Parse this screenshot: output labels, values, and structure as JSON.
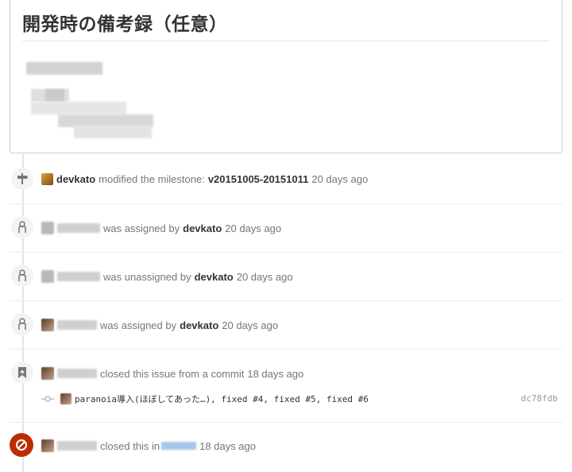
{
  "comment": {
    "title": "開発時の備考録（任意）"
  },
  "events": [
    {
      "type": "milestone",
      "actor": "devkato",
      "action": "modified the milestone:",
      "milestone": "v20151005-20151011",
      "time": "20 days ago"
    },
    {
      "type": "assign",
      "action": "was assigned by",
      "actor": "devkato",
      "time": "20 days ago"
    },
    {
      "type": "unassign",
      "action": "was unassigned by",
      "actor": "devkato",
      "time": "20 days ago"
    },
    {
      "type": "assign",
      "action": "was assigned by",
      "actor": "devkato",
      "time": "20 days ago"
    },
    {
      "type": "closed-commit",
      "action": "closed this issue from a commit",
      "time": "18 days ago",
      "commit": {
        "message": "paranoia導入(ほぼしてあった…), fixed #4, fixed #5, fixed #6",
        "sha": "dc78fdb"
      }
    },
    {
      "type": "closed",
      "action": "closed this in",
      "time": "18 days ago"
    }
  ],
  "colors": {
    "closed_badge": "#bd2c00",
    "badge_bg": "#f3f3f3",
    "muted_text": "#767676"
  },
  "icons": {
    "milestone": "milestone-icon",
    "person": "person-icon",
    "bookmark": "bookmark-icon",
    "closed": "circle-slash-icon",
    "commit": "git-commit-icon"
  }
}
